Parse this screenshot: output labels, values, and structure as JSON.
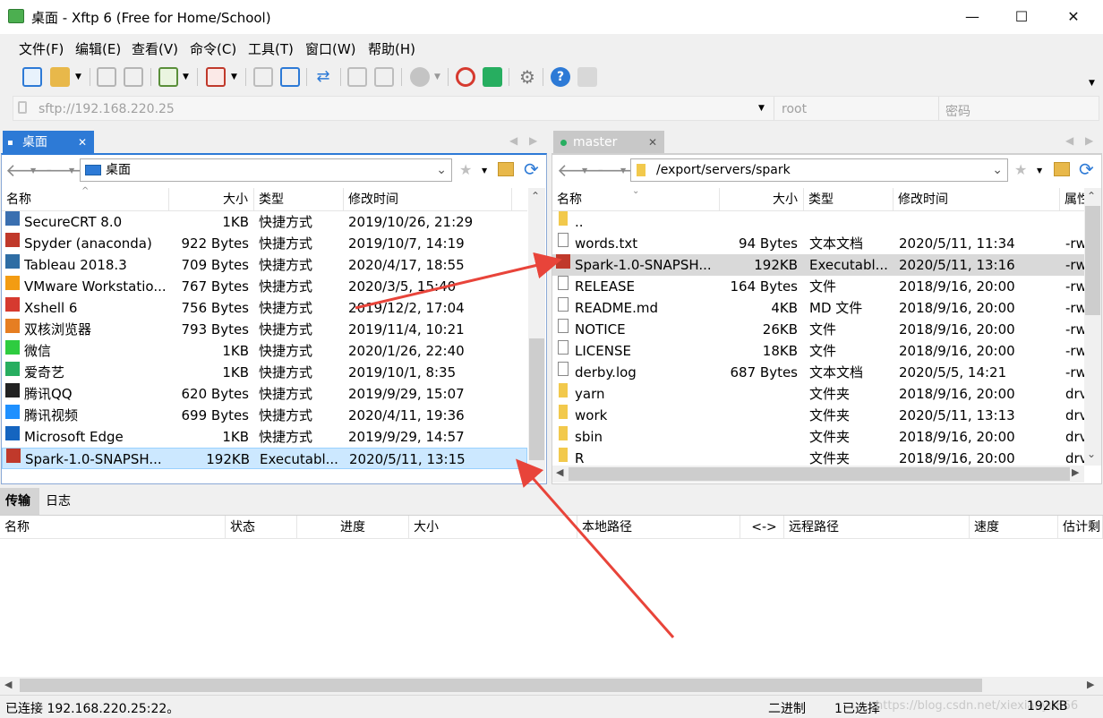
{
  "window": {
    "title": "桌面 - Xftp 6 (Free for Home/School)",
    "minimize": "—",
    "maximize": "☐",
    "close": "✕"
  },
  "menu": [
    "文件(F)",
    "编辑(E)",
    "查看(V)",
    "命令(C)",
    "工具(T)",
    "窗口(W)",
    "帮助(H)"
  ],
  "address": {
    "host": "sftp://192.168.220.25",
    "user_placeholder": "root",
    "password_placeholder": "密码"
  },
  "left": {
    "tab_label": "桌面",
    "path": "桌面",
    "columns": [
      "名称",
      "大小",
      "类型",
      "修改时间"
    ],
    "rows": [
      {
        "name": "SecureCRT 8.0",
        "size": "1KB",
        "type": "快捷方式",
        "mtime": "2019/10/26, 21:29",
        "icon": "securecrt-icon",
        "color": "#3a6fb0"
      },
      {
        "name": "Spyder (anaconda)",
        "size": "922 Bytes",
        "type": "快捷方式",
        "mtime": "2019/10/7, 14:19",
        "icon": "spyder-icon",
        "color": "#c0392b"
      },
      {
        "name": "Tableau 2018.3",
        "size": "709 Bytes",
        "type": "快捷方式",
        "mtime": "2020/4/17, 18:55",
        "icon": "tableau-icon",
        "color": "#2e6da4"
      },
      {
        "name": "VMware Workstatio...",
        "size": "767 Bytes",
        "type": "快捷方式",
        "mtime": "2020/3/5, 15:40",
        "icon": "vmware-icon",
        "color": "#f39c12"
      },
      {
        "name": "Xshell 6",
        "size": "756 Bytes",
        "type": "快捷方式",
        "mtime": "2019/12/2, 17:04",
        "icon": "xshell-icon",
        "color": "#d63a2f"
      },
      {
        "name": "双核浏览器",
        "size": "793 Bytes",
        "type": "快捷方式",
        "mtime": "2019/11/4, 10:21",
        "icon": "browser-icon",
        "color": "#e67e22"
      },
      {
        "name": "微信",
        "size": "1KB",
        "type": "快捷方式",
        "mtime": "2020/1/26, 22:40",
        "icon": "wechat-icon",
        "color": "#2ecc40"
      },
      {
        "name": "爱奇艺",
        "size": "1KB",
        "type": "快捷方式",
        "mtime": "2019/10/1, 8:35",
        "icon": "iqiyi-icon",
        "color": "#27ae60"
      },
      {
        "name": "腾讯QQ",
        "size": "620 Bytes",
        "type": "快捷方式",
        "mtime": "2019/9/29, 15:07",
        "icon": "qq-icon",
        "color": "#222222"
      },
      {
        "name": "腾讯视频",
        "size": "699 Bytes",
        "type": "快捷方式",
        "mtime": "2020/4/11, 19:36",
        "icon": "tencent-video-icon",
        "color": "#1e90ff"
      },
      {
        "name": "Microsoft Edge",
        "size": "1KB",
        "type": "快捷方式",
        "mtime": "2019/9/29, 14:57",
        "icon": "edge-icon",
        "color": "#1565c0"
      },
      {
        "name": "Spark-1.0-SNAPSH...",
        "size": "192KB",
        "type": "Executabl...",
        "mtime": "2020/5/11, 13:15",
        "icon": "jar-icon",
        "color": "#c0392b"
      }
    ]
  },
  "right": {
    "tab_label": "master",
    "path": "/export/servers/spark",
    "columns": [
      "名称",
      "大小",
      "类型",
      "修改时间",
      "属性"
    ],
    "rows": [
      {
        "name": "..",
        "size": "",
        "type": "",
        "mtime": "",
        "attr": "",
        "icon": "folder-up-icon",
        "color": "#f2c94c"
      },
      {
        "name": "words.txt",
        "size": "94 Bytes",
        "type": "文本文档",
        "mtime": "2020/5/11, 11:34",
        "attr": "-rw",
        "icon": "text-file-icon",
        "color": "#888888"
      },
      {
        "name": "Spark-1.0-SNAPSH...",
        "size": "192KB",
        "type": "Executabl...",
        "mtime": "2020/5/11, 13:16",
        "attr": "-rw",
        "icon": "jar-icon",
        "color": "#c0392b"
      },
      {
        "name": "RELEASE",
        "size": "164 Bytes",
        "type": "文件",
        "mtime": "2018/9/16, 20:00",
        "attr": "-rw",
        "icon": "file-icon",
        "color": "#888888"
      },
      {
        "name": "README.md",
        "size": "4KB",
        "type": "MD 文件",
        "mtime": "2018/9/16, 20:00",
        "attr": "-rw",
        "icon": "file-icon",
        "color": "#888888"
      },
      {
        "name": "NOTICE",
        "size": "26KB",
        "type": "文件",
        "mtime": "2018/9/16, 20:00",
        "attr": "-rw",
        "icon": "file-icon",
        "color": "#888888"
      },
      {
        "name": "LICENSE",
        "size": "18KB",
        "type": "文件",
        "mtime": "2018/9/16, 20:00",
        "attr": "-rw",
        "icon": "file-icon",
        "color": "#888888"
      },
      {
        "name": "derby.log",
        "size": "687 Bytes",
        "type": "文本文档",
        "mtime": "2020/5/5, 14:21",
        "attr": "-rw",
        "icon": "text-file-icon",
        "color": "#888888"
      },
      {
        "name": "yarn",
        "size": "",
        "type": "文件夹",
        "mtime": "2018/9/16, 20:00",
        "attr": "drv",
        "icon": "folder-icon",
        "color": "#f2c94c"
      },
      {
        "name": "work",
        "size": "",
        "type": "文件夹",
        "mtime": "2020/5/11, 13:13",
        "attr": "drv",
        "icon": "folder-icon",
        "color": "#f2c94c"
      },
      {
        "name": "sbin",
        "size": "",
        "type": "文件夹",
        "mtime": "2018/9/16, 20:00",
        "attr": "drv",
        "icon": "folder-icon",
        "color": "#f2c94c"
      },
      {
        "name": "R",
        "size": "",
        "type": "文件夹",
        "mtime": "2018/9/16, 20:00",
        "attr": "drv",
        "icon": "folder-icon",
        "color": "#f2c94c"
      }
    ]
  },
  "transfer": {
    "tabs": [
      "传输",
      "日志"
    ],
    "columns": [
      "名称",
      "状态",
      "进度",
      "大小",
      "本地路径",
      "<->",
      "远程路径",
      "速度",
      "估计剩"
    ]
  },
  "status": {
    "connection": "已连接 192.168.220.25:22。",
    "mode": "二进制",
    "selection": "1已选择",
    "size": "192KB",
    "watermark": "https://blog.csdn.net/xiexiaoyu666"
  },
  "colors": {
    "accent": "#2d7ad6",
    "selection": "#cce8ff",
    "arrow": "#e8443a"
  }
}
